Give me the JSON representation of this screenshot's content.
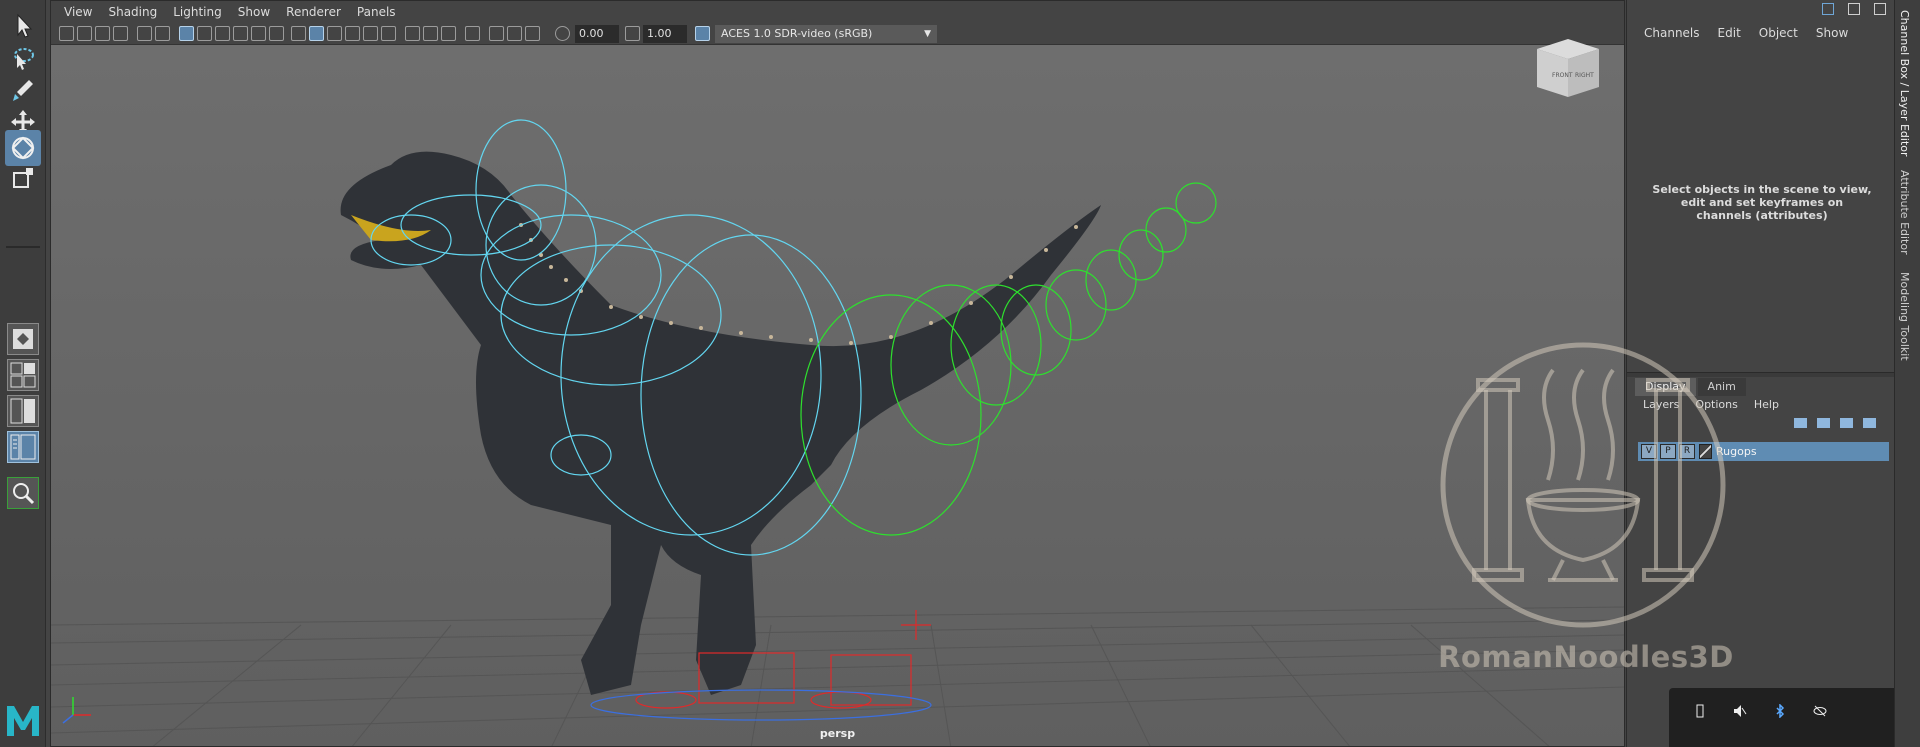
{
  "viewport": {
    "menus": [
      "View",
      "Shading",
      "Lighting",
      "Show",
      "Renderer",
      "Panels"
    ],
    "exposure": "0.00",
    "gamma": "1.00",
    "color_space": "ACES 1.0 SDR-video (sRGB)",
    "camera": "persp",
    "viewcube": {
      "front": "FRONT",
      "right": "RIGHT"
    }
  },
  "channel_box": {
    "menus": [
      "Channels",
      "Edit",
      "Object",
      "Show"
    ],
    "hint": "Select objects in the scene to view, edit and set keyframes on channels (attributes)"
  },
  "layer_editor": {
    "tabs": [
      "Display",
      "Anim"
    ],
    "menus": [
      "Layers",
      "Options",
      "Help"
    ],
    "layers": [
      {
        "name": "Rugops",
        "v": "V",
        "p": "P",
        "r": "R"
      }
    ]
  },
  "dock_tabs": [
    "Channel Box / Layer Editor",
    "Attribute Editor",
    "Modeling Toolkit"
  ],
  "watermark": "RomanNoodles3D",
  "colors": {
    "selection": "#5b83a8",
    "viewport_bg": "#6b6b6b",
    "ui_bg": "#444444",
    "control_blue": "#63d6f0",
    "control_green": "#2ee02e",
    "control_red": "#e02a2a"
  },
  "icons": [
    "select-icon",
    "lasso-icon",
    "paint-select-icon",
    "move-icon",
    "rotate-icon",
    "scale-icon",
    "single-view-icon",
    "four-view-icon",
    "two-view-icon",
    "outliner-layout-icon",
    "search-icon",
    "maya-logo"
  ]
}
